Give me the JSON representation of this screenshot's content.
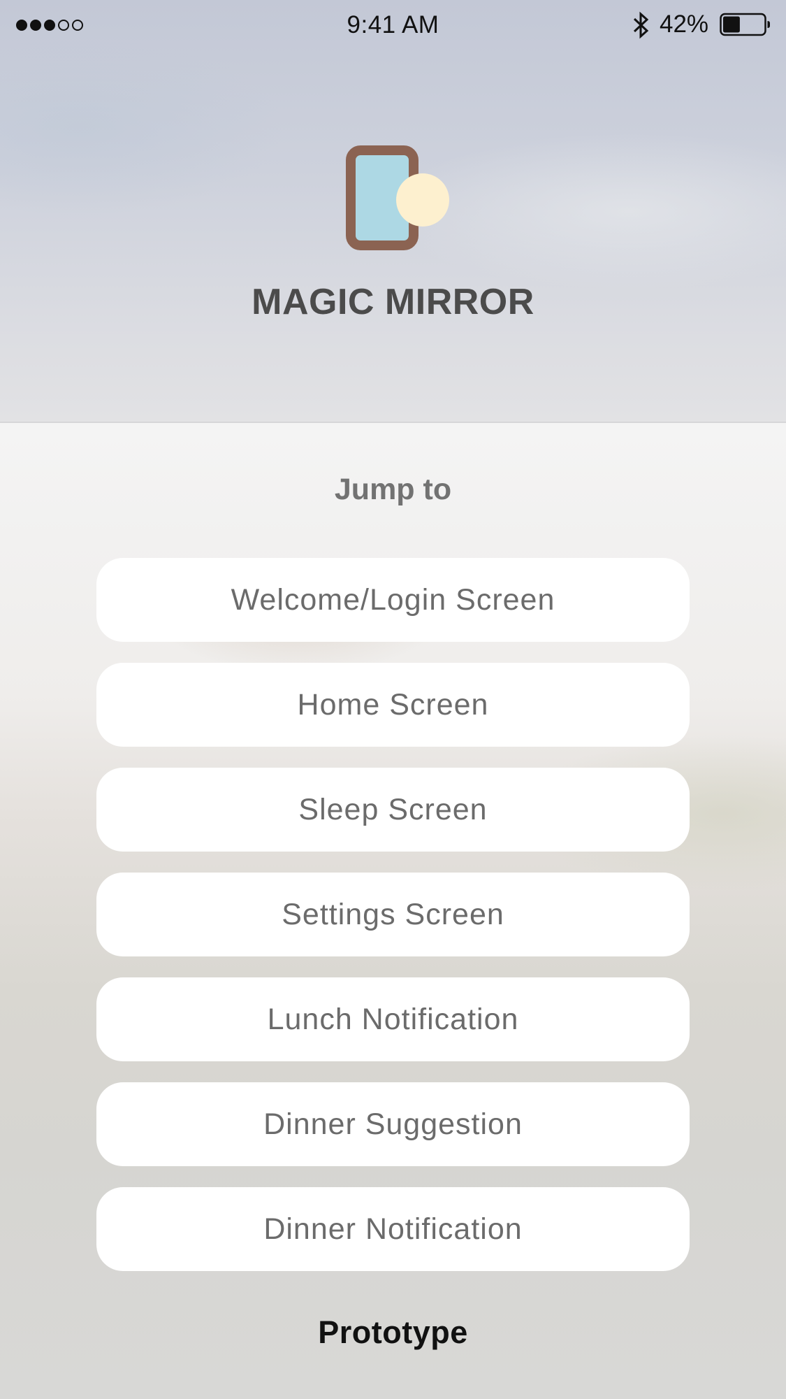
{
  "status_bar": {
    "signal_dots": [
      "full",
      "full",
      "full",
      "empty",
      "empty"
    ],
    "time": "9:41 AM",
    "bluetooth_icon": "bluetooth-icon",
    "battery_percent": "42%",
    "battery_level": 0.42
  },
  "app": {
    "title": "MAGIC MIRROR",
    "logo_icon": "mirror-icon",
    "colors": {
      "frame": "#8b6352",
      "glass": "#add8e4",
      "light": "#fdf0cf",
      "title": "#4b4b4b"
    }
  },
  "menu": {
    "heading": "Jump to",
    "items": [
      {
        "label": "Welcome/Login Screen"
      },
      {
        "label": "Home Screen"
      },
      {
        "label": "Sleep Screen"
      },
      {
        "label": "Settings Screen"
      },
      {
        "label": "Lunch Notification"
      },
      {
        "label": "Dinner Suggestion"
      },
      {
        "label": "Dinner Notification"
      }
    ]
  },
  "footer": {
    "label": "Prototype"
  }
}
